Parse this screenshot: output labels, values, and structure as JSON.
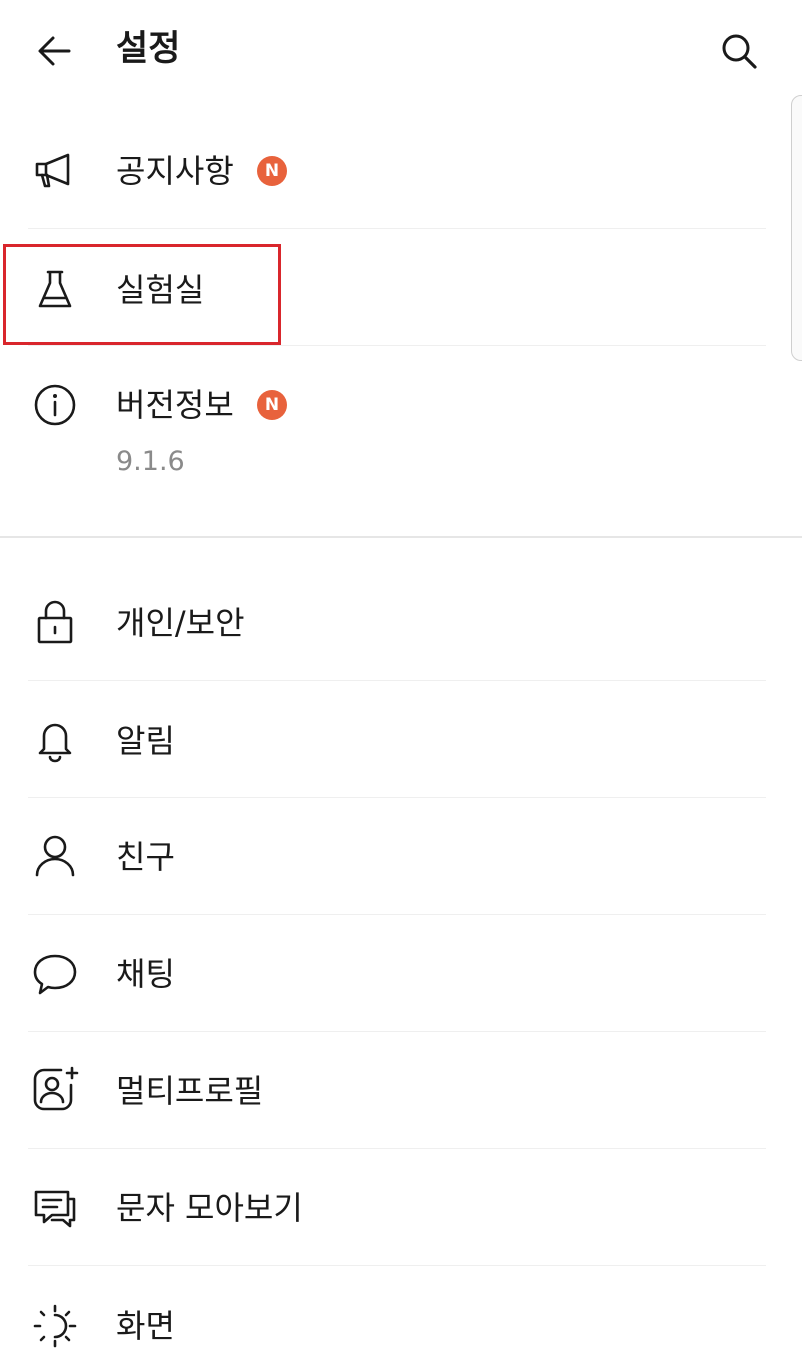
{
  "header": {
    "title": "설정",
    "back_icon": "arrow-left-icon",
    "search_icon": "search-icon"
  },
  "top_section": [
    {
      "icon": "megaphone-icon",
      "label": "공지사항",
      "badge": "N"
    },
    {
      "icon": "flask-icon",
      "label": "실험실",
      "highlighted": true
    },
    {
      "icon": "info-icon",
      "label": "버전정보",
      "badge": "N",
      "subtext": "9.1.6"
    }
  ],
  "menu": [
    {
      "icon": "lock-icon",
      "label": "개인/보안"
    },
    {
      "icon": "bell-icon",
      "label": "알림"
    },
    {
      "icon": "person-icon",
      "label": "친구"
    },
    {
      "icon": "chat-bubble-icon",
      "label": "채팅"
    },
    {
      "icon": "multi-profile-icon",
      "label": "멀티프로필"
    },
    {
      "icon": "message-collection-icon",
      "label": "문자 모아보기"
    },
    {
      "icon": "brightness-icon",
      "label": "화면"
    }
  ],
  "colors": {
    "badge": "#e8623c",
    "highlight_border": "#d9262c",
    "subtext": "#8a8a8a"
  }
}
